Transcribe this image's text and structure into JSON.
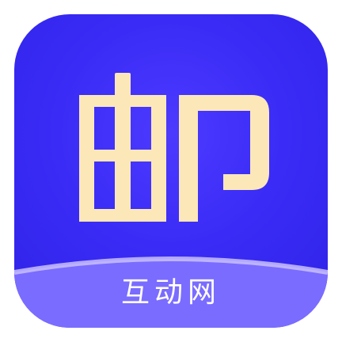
{
  "app_icon": {
    "glyph": "邮",
    "caption": "互动网",
    "colors": {
      "background_center": "#4d3aff",
      "background_edge": "#2f22e6",
      "glyph_fill": "#fbe7b8",
      "band_fill": "#7a6cff",
      "band_highlight": "#c9bfff",
      "caption_text": "#ffffff"
    }
  }
}
